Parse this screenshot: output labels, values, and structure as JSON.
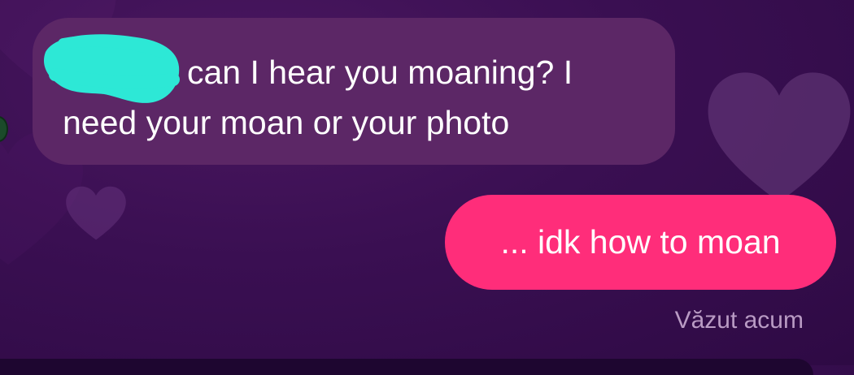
{
  "conversation": {
    "messages": [
      {
        "direction": "incoming",
        "lines": [
          "can I hear you moaning? I",
          "need your moan or your photo"
        ],
        "sender_name_redacted": true
      },
      {
        "direction": "outgoing",
        "text": "... idk how to moan"
      }
    ],
    "seen_status": "Văzut acum"
  },
  "colors": {
    "background": "#3a0f52",
    "incoming_bubble": "#5c2766",
    "outgoing_bubble": "#ff2d7a",
    "redaction_scribble": "#2de8d6",
    "seen_text": "#b99bc4",
    "message_text": "#ffffff"
  },
  "icons": [
    "heart-icon"
  ]
}
